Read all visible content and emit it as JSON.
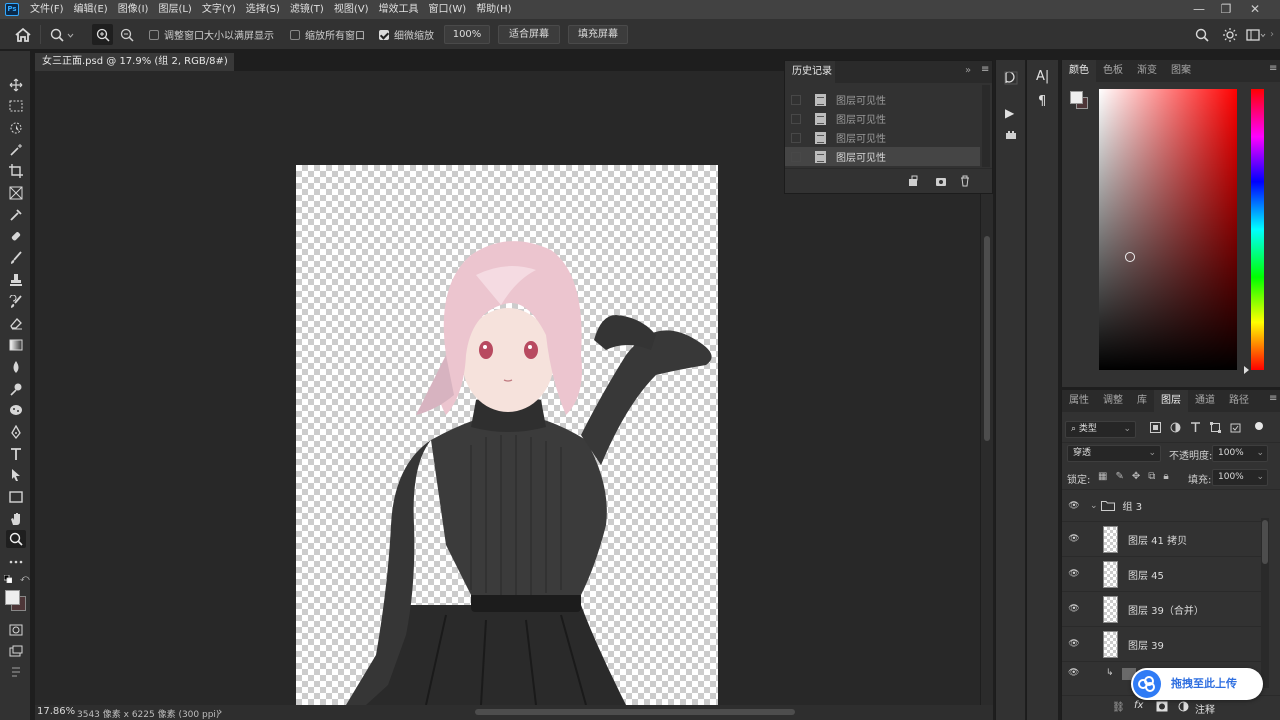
{
  "app": {
    "logo": "Ps"
  },
  "menu": [
    "文件(F)",
    "编辑(E)",
    "图像(I)",
    "图层(L)",
    "文字(Y)",
    "选择(S)",
    "滤镜(T)",
    "视图(V)",
    "增效工具",
    "窗口(W)",
    "帮助(H)"
  ],
  "window_controls": [
    "minimize-icon",
    "restore-icon",
    "close-icon"
  ],
  "options": {
    "resize_windows": {
      "label": "调整窗口大小以满屏显示",
      "checked": false
    },
    "zoom_all": {
      "label": "缩放所有窗口",
      "checked": false
    },
    "scrubby_zoom": {
      "label": "细微缩放",
      "checked": true
    },
    "zoom_value": "100%",
    "fit_screen": "适合屏幕",
    "fill_screen": "填充屏幕"
  },
  "document": {
    "tab_title": "女三正面.psd @ 17.9% (组 2, RGB/8#) *",
    "close": "×"
  },
  "status": {
    "zoom": "17.86%",
    "info": "3543 像素 x 6225 像素 (300 ppi)",
    "arrow": "›"
  },
  "history": {
    "title": "历史记录",
    "items": [
      "图层可见性",
      "图层可见性",
      "图层可见性",
      "图层可见性"
    ],
    "selected_index": 3
  },
  "color_panel": {
    "tabs": [
      "颜色",
      "色板",
      "渐变",
      "图案"
    ],
    "active": "颜色"
  },
  "layers_panel": {
    "tabs": [
      "属性",
      "调整",
      "库",
      "图层",
      "通道",
      "路径"
    ],
    "active": "图层",
    "filter_kind": "类型",
    "blend_mode": "穿透",
    "opacity_label": "不透明度:",
    "opacity_value": "100%",
    "lock_label": "锁定:",
    "fill_label": "填充:",
    "fill_value": "100%",
    "group_name": "组 3",
    "layers": [
      "图层 41 拷贝",
      "图层 45",
      "图层 39（合并）",
      "图层 39"
    ],
    "footer_note": "注释"
  },
  "upload_button": "拖拽至此上传",
  "colors": {
    "accent": "#31a8ff",
    "upload_blue": "#2f7bf5",
    "panel_bg": "#323232"
  }
}
